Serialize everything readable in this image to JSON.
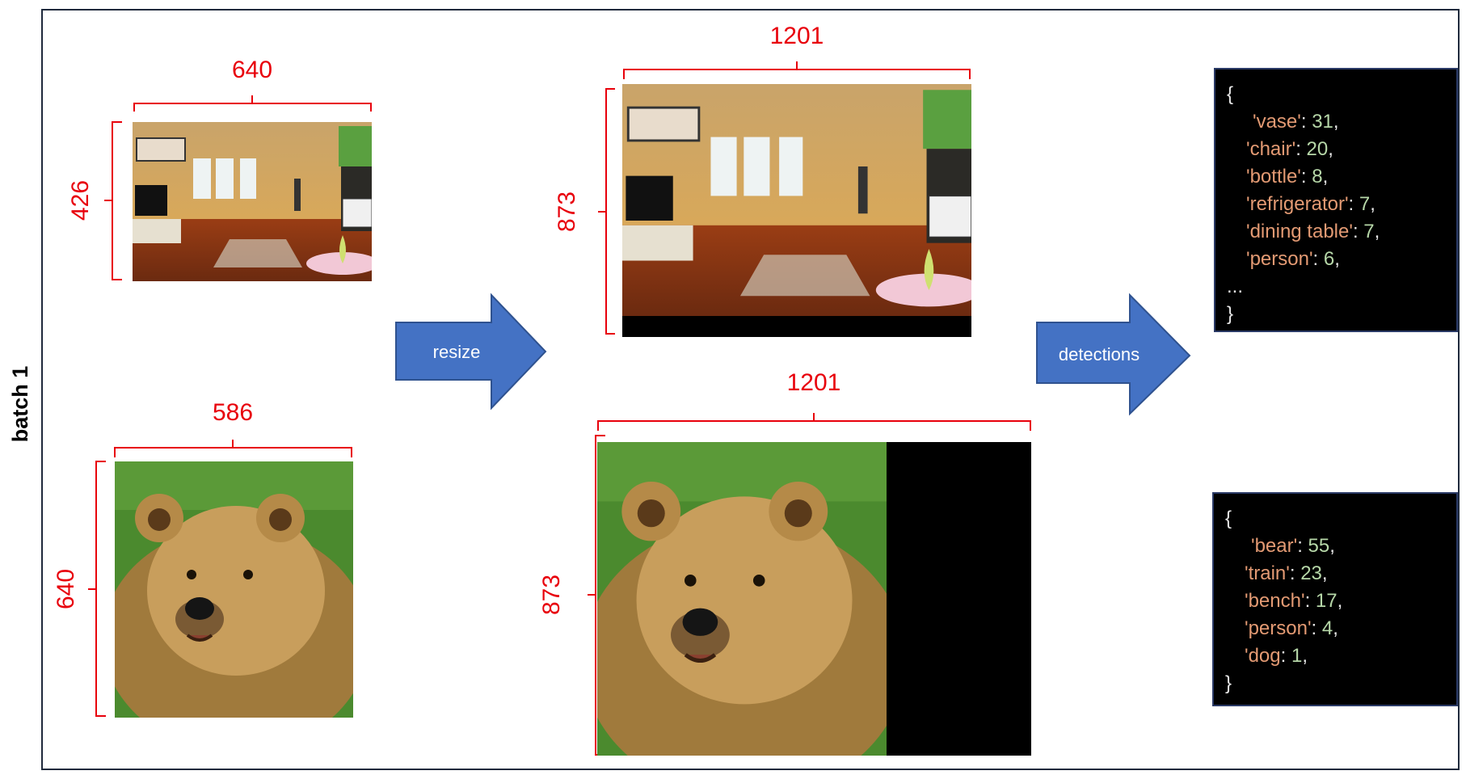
{
  "batch_label": "batch 1",
  "arrows": {
    "resize": "resize",
    "detections": "detections"
  },
  "dims": {
    "img1_w": "640",
    "img1_h": "426",
    "img2_w": "586",
    "img2_h": "640",
    "out1_w": "1201",
    "out1_h": "873",
    "out2_w": "1201",
    "out2_h": "873"
  },
  "detections_top": {
    "open": "{",
    "items": [
      {
        "key": "'vase'",
        "value": "31"
      },
      {
        "key": "'chair'",
        "value": "20"
      },
      {
        "key": "'bottle'",
        "value": "8"
      },
      {
        "key": "'refrigerator'",
        "value": "7"
      },
      {
        "key": "'dining table'",
        "value": "7"
      },
      {
        "key": "'person'",
        "value": "6"
      }
    ],
    "ellipsis": "...",
    "close": "}"
  },
  "detections_bottom": {
    "open": "{",
    "items": [
      {
        "key": "'bear'",
        "value": "55"
      },
      {
        "key": "'train'",
        "value": "23"
      },
      {
        "key": "'bench'",
        "value": "17"
      },
      {
        "key": "'person'",
        "value": "4"
      },
      {
        "key": "'dog",
        "value": "1"
      }
    ],
    "close": "}"
  },
  "colors": {
    "dimension": "#e8000b",
    "arrow": "#4472c4",
    "json_bg": "#000000"
  }
}
